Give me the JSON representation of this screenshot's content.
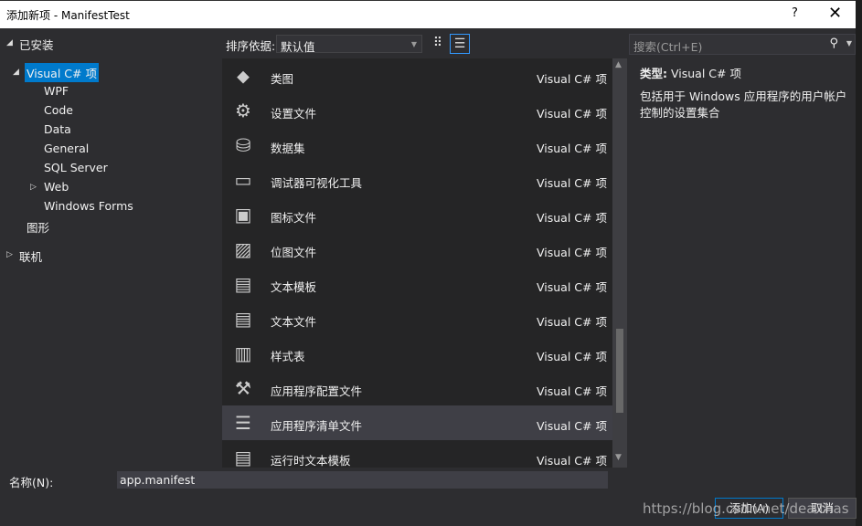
{
  "window": {
    "title": "添加新项 - ManifestTest",
    "help_label": "?",
    "close_icon": "close-icon"
  },
  "tree": {
    "installed": "已安装",
    "root": "Visual C# 项",
    "children": [
      "WPF",
      "Code",
      "Data",
      "General",
      "SQL Server",
      "Web",
      "Windows Forms"
    ],
    "graphics": "图形",
    "online": "联机"
  },
  "toolbar": {
    "sort_label": "排序依据:",
    "sort_value": "默认值"
  },
  "search": {
    "placeholder": "搜索(Ctrl+E)"
  },
  "items": [
    {
      "name": "类图",
      "type": "Visual C# 项",
      "icon": "class-diagram-icon",
      "glyph": "⬥"
    },
    {
      "name": "设置文件",
      "type": "Visual C# 项",
      "icon": "gear-icon",
      "glyph": "⚙"
    },
    {
      "name": "数据集",
      "type": "Visual C# 项",
      "icon": "database-icon",
      "glyph": "⛁"
    },
    {
      "name": "调试器可视化工具",
      "type": "Visual C# 项",
      "icon": "debugger-visualizer-icon",
      "glyph": "▭"
    },
    {
      "name": "图标文件",
      "type": "Visual C# 项",
      "icon": "icon-file-icon",
      "glyph": "▣"
    },
    {
      "name": "位图文件",
      "type": "Visual C# 项",
      "icon": "bitmap-icon",
      "glyph": "▨"
    },
    {
      "name": "文本模板",
      "type": "Visual C# 项",
      "icon": "text-template-icon",
      "glyph": "▤"
    },
    {
      "name": "文本文件",
      "type": "Visual C# 项",
      "icon": "text-file-icon",
      "glyph": "▤"
    },
    {
      "name": "样式表",
      "type": "Visual C# 项",
      "icon": "stylesheet-icon",
      "glyph": "▥"
    },
    {
      "name": "应用程序配置文件",
      "type": "Visual C# 项",
      "icon": "config-file-icon",
      "glyph": "⚒"
    },
    {
      "name": "应用程序清单文件",
      "type": "Visual C# 项",
      "icon": "manifest-icon",
      "glyph": "☰",
      "selected": true
    },
    {
      "name": "运行时文本模板",
      "type": "Visual C# 项",
      "icon": "runtime-text-template-icon",
      "glyph": "▤"
    }
  ],
  "details": {
    "type_label": "类型:",
    "type_value": "Visual C# 项",
    "description": "包括用于 Windows 应用程序的用户帐户控制的设置集合"
  },
  "name_field": {
    "label": "名称(N):",
    "value": "app.manifest"
  },
  "buttons": {
    "add": "添加(A)",
    "cancel": "取消"
  },
  "watermark": "https://blog.csdn.net/dea    thas",
  "colors": {
    "accent": "#007acc",
    "background": "#2d2d30",
    "list_bg": "#252526",
    "selected_row": "#3f3f46"
  }
}
